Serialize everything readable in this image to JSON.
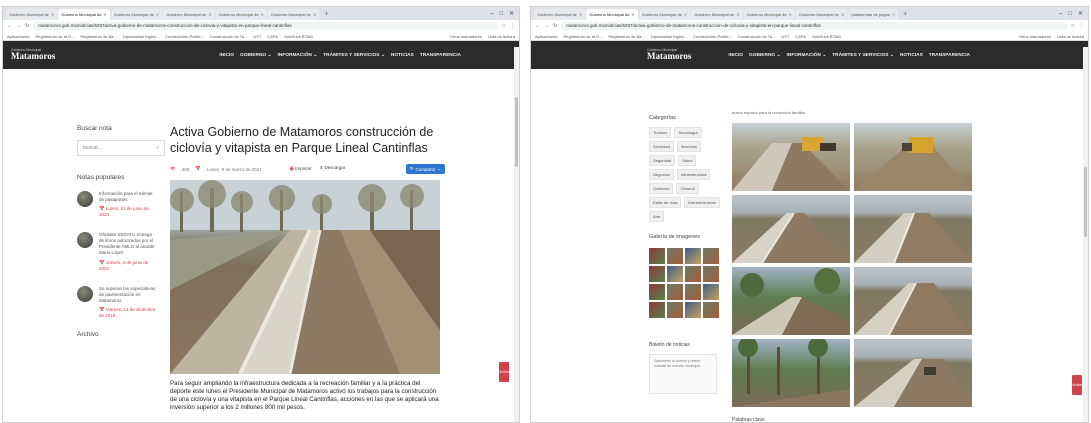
{
  "left": {
    "tabs": [
      "Gobierno Municipal de",
      "Gobierno Municipal de",
      "Gobierno Municipal de",
      "Gobierno Municipal de",
      "Gobierno Municipal de",
      "Gobierno Municipal de"
    ],
    "url": "matamoros.gob.mx/noticias/6297activa-gobierno-de-matamoros-construccion-de-ciclovia-y-vitapista-en-parque-lineal-cantinflas",
    "bookmarks": [
      "Aplicaciones",
      "Reglamento de la G...",
      "Reglamento de Ba...",
      "Diplomados Ingles...",
      "Construcción Públic...",
      "Construcción de Ta...",
      "UST",
      "CAPA",
      "OneDrive BTAM"
    ],
    "bookmarks_right": "Otros marcadores",
    "reading_list": "Lista de lectura",
    "logo_small": "Gobierno Municipal",
    "logo": "Matamoros",
    "menu": [
      "INICIO",
      "GOBIERNO",
      "INFORMACIÓN",
      "TRÁMITES Y SERVICIOS",
      "NOTICIAS",
      "TRANSPARENCIA"
    ],
    "search_heading": "Buscar nota",
    "search_placeholder": "buscar...",
    "popular_heading": "Notas populares",
    "popular": [
      {
        "title": "Información para el trámite de pasaportes",
        "date": "Lunes, 22 de junio de 2020"
      },
      {
        "title": "Oficiales SEDATU entrega de libros autorizados por el Presidente AMLO al alcalde Mario López",
        "date": "Jueves, 4 de junio de 2020"
      },
      {
        "title": "Se superan las expectativas de pavimentación en Matamoros",
        "date": "Viernes, 14 de diciembre de 2018"
      }
    ],
    "archive_heading": "Archivo",
    "article": {
      "title": "Activa Gobierno de Matamoros construcción de ciclovía y vitapista en Parque Lineal Cantinflas",
      "views": "309",
      "date": "Lunes, 8 de marzo de 2021",
      "print": "Imprimir",
      "download": "Descargar",
      "share": "Compartir",
      "body": "Para seguir ampliando la infraestructura dedicada a la recreación familiar y a la práctica del deporte este lunes el Presidente Municipal de Matamoros activó los trabajos para la construcción de una ciclovía y una vitapista en el Parque Lineal Cantinflas, acciones en las que se aplicará una inversión superior a los 2 millones 800 mil pesos."
    },
    "float": "Arriba"
  },
  "right": {
    "tabs": [
      "Gobierno Municipal de",
      "Gobierno Municipal de",
      "Gobierno Municipal de",
      "Gobierno Municipal de",
      "Gobierno Municipal de",
      "Gobierno Municipal de",
      "plataformas de pagos"
    ],
    "url": "matamoros.gob.mx/noticias/6297/activa-gobierno-de-matamoros-construccion-de-ciclovia-y-vitapista-en-parque-lineal-cantinflas",
    "bookmarks": [
      "Aplicaciones",
      "Reglamento de la G...",
      "Reglamento de Ba...",
      "Diplomados Ingles...",
      "Construcción Públic...",
      "Construcción de Ta...",
      "UST",
      "CAPA",
      "OneDrive BTAM"
    ],
    "bookmarks_right": "Otros marcadores",
    "reading_list": "Lista de lectura",
    "logo_small": "Gobierno Municipal",
    "logo": "Matamoros",
    "menu": [
      "INICIO",
      "GOBIERNO",
      "INFORMACIÓN",
      "TRÁMITES Y SERVICIOS",
      "NOTICIAS",
      "TRANSPARENCIA"
    ],
    "intro": "nuevo espacio para la recreación familiar.",
    "categories_heading": "Categorías",
    "categories": [
      "Turismo",
      "Tecnología",
      "Sociedad",
      "Servicios",
      "Seguridad",
      "Salud",
      "Negocios",
      "Infraestructura",
      "Gobierno",
      "General",
      "Estilo de Vida",
      "Entretenimiento",
      "Arte"
    ],
    "gallery_heading": "Galería de imagenes",
    "newsletter_heading": "Boletín de noticias",
    "newsletter_text": "Suscríbete al boletín y recibe noticias de nuestro municipio.",
    "keywords_heading": "Palabras clave",
    "float": "Arriba"
  }
}
